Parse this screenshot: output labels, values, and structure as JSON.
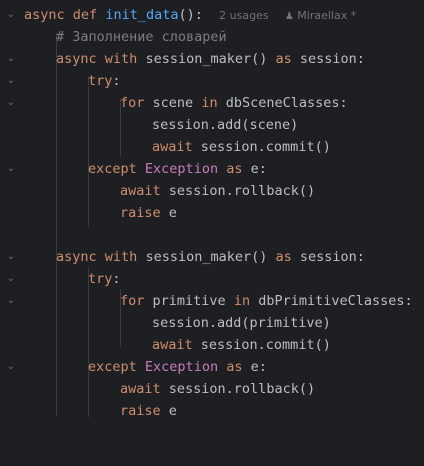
{
  "editor": {
    "function_header": {
      "kw_async": "async",
      "kw_def": "def",
      "name": "init_data",
      "tail": "():",
      "usages": "2 usages",
      "author_icon": "person-icon",
      "author": "Miraellax *"
    },
    "comment": "# Заполнение словарей",
    "block1": {
      "l_async": "async",
      "l_with": "with",
      "l_call": "session_maker()",
      "l_as": "as",
      "l_var": "session:",
      "try": "try",
      "colon": ":",
      "for": "for",
      "loop_var": "scene",
      "in": "in",
      "iterable": "dbSceneClasses:",
      "add_call": "session.add(scene)",
      "await": "await",
      "commit_call": "session.commit()",
      "except": "except",
      "exc_class": "Exception",
      "as": "as",
      "exc_var": "e:",
      "rollback_call": "session.rollback()",
      "raise": "raise",
      "raise_var": "e"
    },
    "block2": {
      "l_async": "async",
      "l_with": "with",
      "l_call": "session_maker()",
      "l_as": "as",
      "l_var": "session:",
      "try": "try",
      "colon": ":",
      "for": "for",
      "loop_var": "primitive",
      "in": "in",
      "iterable": "dbPrimitiveClasses:",
      "add_call": "session.add(primitive)",
      "await": "await",
      "commit_call": "session.commit()",
      "except": "except",
      "exc_class": "Exception",
      "as": "as",
      "exc_var": "e:",
      "rollback_call": "session.rollback()",
      "raise": "raise",
      "raise_var": "e"
    },
    "fold_icon": "chevron-down-icon",
    "colors": {
      "background": "#1e1f22",
      "keyword": "#cf8e6d",
      "function": "#56a8f5",
      "class": "#c77dbb",
      "comment": "#7a7e85",
      "text": "#bcbec4"
    }
  }
}
